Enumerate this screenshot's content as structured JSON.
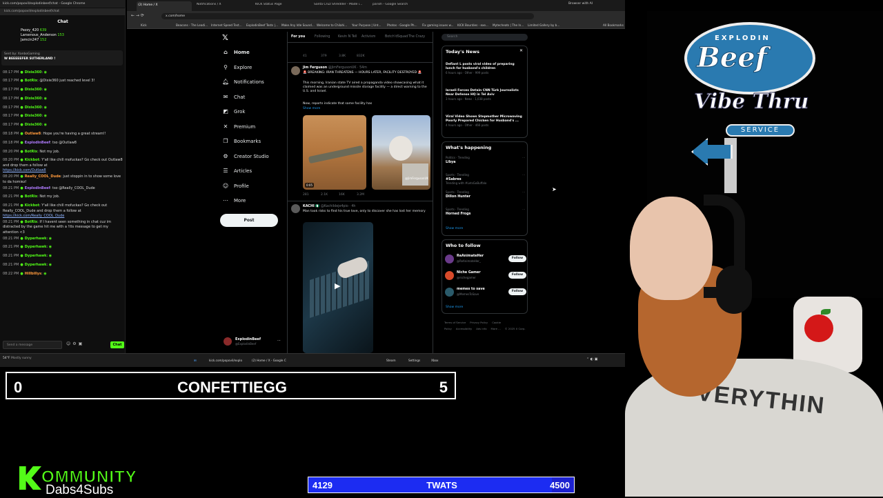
{
  "chat_window": {
    "title": "kick.com/popovil/explodinbeef/chat - Google Chrome",
    "url": "kick.com/popovil/explodinbeef/chat",
    "header": "Chat",
    "leaderboard": [
      {
        "name": "Pezzy_420",
        "value": "639"
      },
      {
        "name": "Larsenous_Anderson",
        "value": "153"
      },
      {
        "name": "Jamcin247",
        "value": "152"
      }
    ],
    "pinned_user": "Sent by: XanboGaming",
    "pinned_text": "W BEEEEEFER SUTHERLAND !",
    "messages": [
      {
        "time": "08:17 PM",
        "user": "Dixie360",
        "text": "",
        "color": "green"
      },
      {
        "time": "08:17 PM",
        "user": "BotRix",
        "text": "@Dixie360 just reached level 3!",
        "color": "green"
      },
      {
        "time": "08:17 PM",
        "user": "Dixie360",
        "text": "",
        "color": "green"
      },
      {
        "time": "08:17 PM",
        "user": "Dixie360",
        "text": "",
        "color": "green"
      },
      {
        "time": "08:17 PM",
        "user": "Dixie360",
        "text": "",
        "color": "green"
      },
      {
        "time": "08:17 PM",
        "user": "Dixie360",
        "text": "",
        "color": "green"
      },
      {
        "time": "08:17 PM",
        "user": "Dixie360",
        "text": "",
        "color": "green"
      },
      {
        "time": "08:18 PM",
        "user": "Outlaw8",
        "text": "Hope you're having a great stream!!",
        "color": "orange"
      },
      {
        "time": "08:18 PM",
        "user": "ExplodinBeef",
        "text": "tso @Outlaw8",
        "color": "purple"
      },
      {
        "time": "08:20 PM",
        "user": "BotRix",
        "text": "Not my job.",
        "color": "green"
      },
      {
        "time": "08:20 PM",
        "user": "Kickbot",
        "text": "Y'all like chill mofuckas? Go check out Outlaw8 and drop them a follow at",
        "link": "https://kick.com/Outlaw8",
        "color": "green"
      },
      {
        "time": "08:20 PM",
        "user": "Really_COOL_Dude",
        "text": "just stoppin in to show some love to da homiez!",
        "color": "orange"
      },
      {
        "time": "08:21 PM",
        "user": "ExplodinBeef",
        "text": "tso @Really_COOL_Dude",
        "color": "purple"
      },
      {
        "time": "08:21 PM",
        "user": "BotRix",
        "text": "Not my job.",
        "color": "green"
      },
      {
        "time": "08:21 PM",
        "user": "Kickbot",
        "text": "Y'all like chill mofuckas? Go check out Really_COOL_Dude and drop them a follow at",
        "link": "https://kick.com/Really_COOL_Dude",
        "color": "green"
      },
      {
        "time": "08:21 PM",
        "user": "BotRix",
        "text": "If I havent seen something in chat cuz im distracted by the game hit me with a !tts message to get my attention <3",
        "color": "green"
      },
      {
        "time": "08:21 PM",
        "user": "Dyperhawk",
        "text": "",
        "color": "green"
      },
      {
        "time": "08:21 PM",
        "user": "Dyperhawk",
        "text": "",
        "color": "green"
      },
      {
        "time": "08:21 PM",
        "user": "Dyperhawk",
        "text": "",
        "color": "green"
      },
      {
        "time": "08:21 PM",
        "user": "Dyperhawk",
        "text": "",
        "color": "green"
      },
      {
        "time": "08:22 PM",
        "user": "Hillbillys",
        "text": "",
        "color": "orange"
      }
    ],
    "input_placeholder": "Send a message",
    "send_label": "Chat"
  },
  "browser": {
    "tabs": [
      {
        "label": "(2) Home / X",
        "active": true
      },
      {
        "label": "Notifications / X",
        "active": false
      },
      {
        "label": "KICK Status Page",
        "active": false
      },
      {
        "label": "Santa Cruz Shredder - Made i...",
        "active": false
      },
      {
        "label": "parish - Google Search",
        "active": false
      }
    ],
    "controls": "Browser with AI",
    "url": "x.com/home",
    "bookmarks": [
      "Kick",
      "Beacons - The Leadi...",
      "Internet Speed Test...",
      "ExplodinBeef Tests |...",
      "Make Any Idle Sound...",
      "Welcome to Chilahi...",
      "Your Purpose | Unt...",
      "Photos - Google Ph...",
      "Fix gaming issues w...",
      "KICK Bounties - exe...",
      "Mytecheats | The In...",
      "Limited Gallery by b...",
      "All Bookmarks"
    ]
  },
  "x_nav": {
    "items": [
      {
        "label": "Home",
        "icon": "home-icon",
        "glyph": "⌂",
        "bold": true
      },
      {
        "label": "Explore",
        "icon": "search-icon",
        "glyph": "⚲"
      },
      {
        "label": "Notifications",
        "icon": "bell-icon",
        "glyph": "🔔︎"
      },
      {
        "label": "Chat",
        "icon": "envelope-icon",
        "glyph": "✉"
      },
      {
        "label": "Grok",
        "icon": "grok-icon",
        "glyph": "◩"
      },
      {
        "label": "Premium",
        "icon": "x-premium-icon",
        "glyph": "✕"
      },
      {
        "label": "Bookmarks",
        "icon": "bookmark-icon",
        "glyph": "❒"
      },
      {
        "label": "Creator Studio",
        "icon": "creator-studio-icon",
        "glyph": "⚙"
      },
      {
        "label": "Articles",
        "icon": "articles-icon",
        "glyph": "☰"
      },
      {
        "label": "Profile",
        "icon": "profile-icon",
        "glyph": "☺"
      },
      {
        "label": "More",
        "icon": "more-icon",
        "glyph": "⋯"
      }
    ],
    "post_label": "Post",
    "account_name": "ExplodinBeef",
    "account_handle": "@ExplodinBeef"
  },
  "feed": {
    "tabs": [
      "For you",
      "Following",
      "Kevin N Tell",
      "Activism",
      "Botch'dSquad",
      "The Crazy"
    ],
    "top_actions": [
      "41",
      "379",
      "3.8K",
      "832K"
    ],
    "tweet1": {
      "name": "Jim Ferguson",
      "handle": "@JimFergusonUK · 54m",
      "headline": "🚨 BREAKING: IRAN THREATENS — HOURS LATER, FACILITY DESTROYED 🚨",
      "body": "This morning, Iranian state TV aired a propaganda video showcasing what it claimed was an underground missile storage facility — a direct warning to the U.S. and Israel.",
      "body2": "Now, reports indicate that same facility has",
      "show_more": "Show more",
      "video_time": "0:05",
      "watermark": "@JimFergusonUK",
      "actions": [
        "281",
        "2.1K",
        "16K",
        "3.2M"
      ]
    },
    "tweet2": {
      "name": "KACHI 🇳🇬",
      "handle": "@KachiIdeje4pio · 4h",
      "body": "Man took risks to find his true love, only to discover she has lost her memory"
    }
  },
  "right_col": {
    "search_placeholder": "Search",
    "news_title": "Today's News",
    "news": [
      {
        "headline": "Defiant L posts viral video of preparing lunch for husband's children",
        "meta": "6 hours ago · Other · 999 posts"
      },
      {
        "headline": "Israeli Forces Detain CNN Türk Journalists Near Defense HQ in Tel Aviv",
        "meta": "3 hours ago · News · 1,038 posts"
      },
      {
        "headline": "Viral Video Shows Stepmother Microwaving Poorly Prepared Chicken for Husband's ...",
        "meta": "4 hours ago · Other · 466 posts"
      }
    ],
    "happening_title": "What's happening",
    "trends": [
      {
        "context": "Politics · Trending",
        "name": "Libya",
        "extra": ""
      },
      {
        "context": "Sports · Trending",
        "name": "#Sabres",
        "extra": "Trending with #LetsGoBuffalo"
      },
      {
        "context": "Sports · Trending",
        "name": "Dillon Hunter",
        "extra": ""
      },
      {
        "context": "Sports · Trending",
        "name": "Horned Frogs",
        "extra": ""
      }
    ],
    "show_more": "Show more",
    "who_title": "Who to follow",
    "who": [
      {
        "name": "ReAnimateHer",
        "handle": "@ReAnimateHer_",
        "color": "#6a3a8a"
      },
      {
        "name": "Niche Gamer",
        "handle": "@nichegamer",
        "color": "#d84a2a"
      },
      {
        "name": "memes to save",
        "handle": "@MemesToSave",
        "color": "#2a5a6a"
      }
    ],
    "follow_label": "Follow",
    "footer": [
      "Terms of Service",
      "Privacy Policy",
      "Cookie Policy",
      "Accessibility",
      "Ads info",
      "More ...",
      "© 2025 X Corp."
    ]
  },
  "taskbar": {
    "weather_temp": "54°F",
    "weather_desc": "Mostly sunny",
    "apps": [
      "kick.com/popovil/explo",
      "(2) Home / X - Google C",
      "Steam",
      "Settings",
      "Xbox"
    ]
  },
  "overlay": {
    "confetti_left": "0",
    "confetti_label": "CONFETTIEGG",
    "confetti_right": "5",
    "twats_left": "4129",
    "twats_label": "TWATS",
    "twats_right": "4500",
    "twats_progress": 0.9176,
    "kommunity_word": "OMMUNITY",
    "kommunity_sub": "Dabs4Subs"
  },
  "logo_sign": {
    "top_word": "EXPLODIN",
    "main_word": "Beef",
    "vibe_text": "Vibe Thru",
    "service_text": "SERVICE"
  },
  "shirt_text": "VERYTHIN"
}
